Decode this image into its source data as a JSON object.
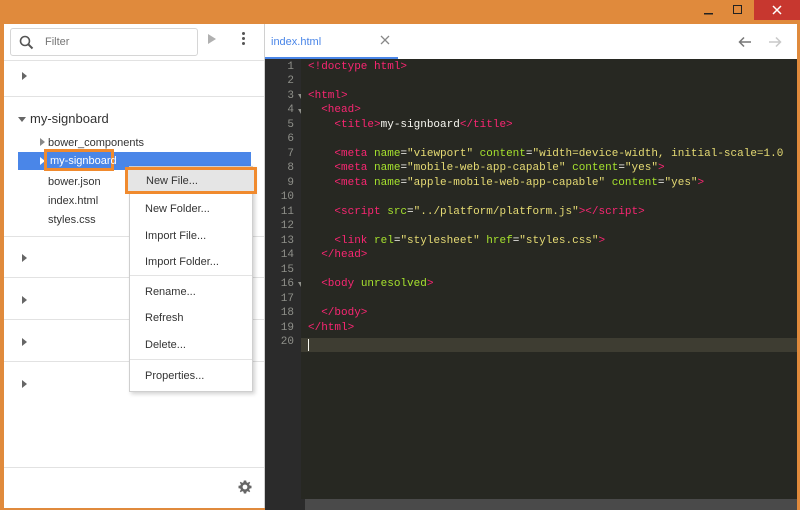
{
  "window": {
    "minimize_icon": "minimize-icon",
    "maximize_icon": "maximize-icon",
    "close_icon": "close-icon",
    "accent": "#e08a3c"
  },
  "sidebar": {
    "search_placeholder": "Filter",
    "project_name": "my-signboard",
    "tree": [
      "bower_components",
      "my-signboard",
      "bower.json",
      "index.html",
      "styles.css"
    ],
    "selected": "my-signboard"
  },
  "context_menu": {
    "new_file": "New File...",
    "new_folder": "New Folder...",
    "import_file": "Import File...",
    "import_folder": "Import Folder...",
    "rename": "Rename...",
    "refresh": "Refresh",
    "delete": "Delete...",
    "properties": "Properties..."
  },
  "editor": {
    "tab_label": "index.html",
    "line_numbers": [
      "1",
      "2",
      "3",
      "4",
      "5",
      "6",
      "7",
      "8",
      "9",
      "10",
      "11",
      "12",
      "13",
      "14",
      "15",
      "16",
      "17",
      "18",
      "19",
      "20"
    ]
  },
  "colors": {
    "selection": "#4a86e8",
    "highlight_box": "#f08a2e",
    "editor_bg": "#272822",
    "tag": "#f92672",
    "attribute": "#a6e22e",
    "string": "#e6db74"
  }
}
